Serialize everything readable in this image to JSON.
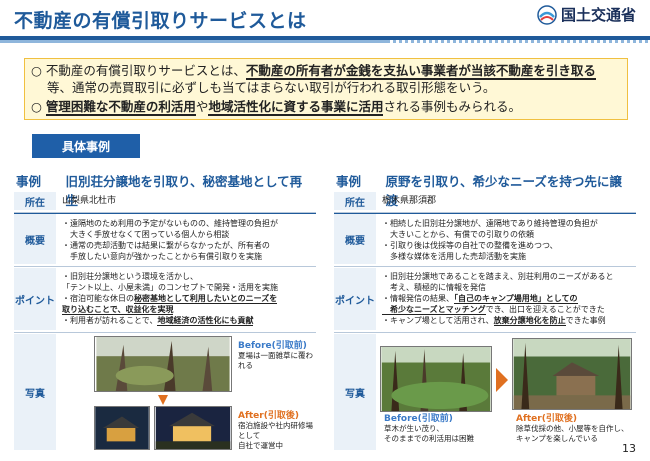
{
  "header": {
    "title": "不動産の有償引取りサービスとは",
    "ministry": "国土交通省"
  },
  "summary": {
    "l1_a": "○ 不動産の有償引取りサービスとは、",
    "l1_b": "不動産の所有者が金銭を支払い事業者が当該不動産を引き取る",
    "l2": "等、通常の売買取引に必ずしも当てはまらない取引が行われる取引形態をいう。",
    "l3_circ": "○",
    "l3_a": "管理困難な不動産の利活用",
    "l3_b": "や",
    "l3_c": "地域活性化に資する事業に活用",
    "l3_d": "される事例もみられる。"
  },
  "tab": "具体事例",
  "labels": {
    "location": "所在",
    "overview": "概要",
    "points": "ポイント",
    "photos": "写真"
  },
  "case1": {
    "num": "事例①",
    "title": "旧別荘分譲地を引取り、秘密基地として再生",
    "location": "山梨県北杜市",
    "ov1": "・遠隔地のため利用の予定がないものの、維持管理の負担が",
    "ov2": "　大きく手放せなくて困っている個人から相談",
    "ov3": "・通常の売却活動では結果に繋がらなかったが、所有者の",
    "ov4": "　手放したい意向が強かったことから有償引取りを実施",
    "p1": "・旧別荘分譲地という環境を活かし、",
    "p2": "「テント以上、小屋未満」のコンセプトで開発・活用を実施",
    "p3a": "・宿泊可能な休日の",
    "p3b": "秘密基地として利用したいとのニーズを",
    "p4": "取り込むことで、収益化を実現",
    "p5a": "・利用者が訪れることで、",
    "p5b": "地域経済の活性化にも貢献",
    "before_label": "Before(引取前)",
    "before_cap": "夏場は一面雑草に覆われる",
    "after_label": "After(引取後)",
    "after_cap1": "宿泊施設や社内研修場として",
    "after_cap2": "自社で運営中"
  },
  "case2": {
    "num": "事例②",
    "title": "原野を引取り、希少なニーズを持つ先に譲渡",
    "location": "栃木県那須郡",
    "ov1": "・相続した旧別荘分譲地が、遠隔地であり維持管理の負担が",
    "ov2": "　大きいことから、有償での引取りの依頼",
    "ov3": "・引取り後は伐採等の自社での整備を進めつつ、",
    "ov4": "　多様な媒体を活用した売却活動を実施",
    "p1": "・旧別荘分譲地であることを踏まえ、別荘利用のニーズがあると",
    "p2": "　考え、積極的に情報を発信",
    "p3a": "・情報発信の結果、",
    "p3b": "「自己のキャンプ場用地」としての",
    "p4a": "　希少なニーズとマッチング",
    "p4b": "でき、出口を迎えることができた",
    "p5a": "・キャンプ場として活用され、",
    "p5b": "放棄分譲地化を防止",
    "p5c": "できた事例",
    "before_label": "Before(引取前)",
    "before_cap1": "草木が生い茂り、",
    "before_cap2": "そのままでの利活用は困難",
    "after_label": "After(引取後)",
    "after_cap1": "除草伐採の他、小屋等を自作し、",
    "after_cap2": "キャンプを楽しんでいる"
  },
  "page_number": "13",
  "colors": {
    "brand": "#1f5a9a",
    "summary_bg": "#fff8d6",
    "before": "#3a7ac8",
    "after": "#e07020"
  }
}
